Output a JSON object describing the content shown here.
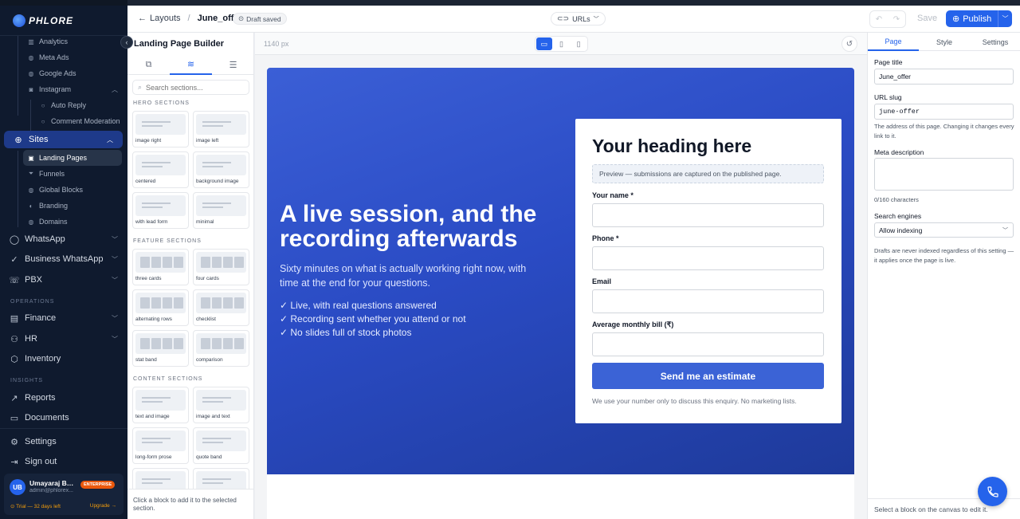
{
  "brand": {
    "logo_text": "PHLORE"
  },
  "sidebar": {
    "items": [
      {
        "label": "Analytics",
        "icon": "chart-icon"
      },
      {
        "label": "Meta Ads",
        "icon": "globe-icon"
      },
      {
        "label": "Google Ads",
        "icon": "globe-icon"
      },
      {
        "label": "Instagram",
        "icon": "camera-icon"
      },
      {
        "label": "Auto Reply",
        "icon": "chat-icon"
      },
      {
        "label": "Comment Moderation",
        "icon": "chat-icon"
      },
      {
        "label": "Sites",
        "icon": "globe-icon"
      },
      {
        "label": "Landing Pages",
        "icon": "layout-icon"
      },
      {
        "label": "Funnels",
        "icon": "funnel-icon"
      },
      {
        "label": "Global Blocks",
        "icon": "globe-icon"
      },
      {
        "label": "Branding",
        "icon": "brush-icon"
      },
      {
        "label": "Domains",
        "icon": "globe-icon"
      },
      {
        "label": "WhatsApp",
        "icon": "whatsapp-icon"
      },
      {
        "label": "Business WhatsApp",
        "icon": "check-circle-icon"
      },
      {
        "label": "PBX",
        "icon": "phone-icon"
      },
      {
        "label": "Finance",
        "icon": "wallet-icon"
      },
      {
        "label": "HR",
        "icon": "people-icon"
      },
      {
        "label": "Inventory",
        "icon": "box-icon"
      },
      {
        "label": "Reports",
        "icon": "trend-icon"
      },
      {
        "label": "Documents",
        "icon": "folder-icon"
      },
      {
        "label": "Settings",
        "icon": "gear-icon"
      },
      {
        "label": "Sign out",
        "icon": "logout-icon"
      }
    ],
    "groups": {
      "operations": "OPERATIONS",
      "insights": "INSIGHTS"
    },
    "user": {
      "initials": "UB",
      "name": "Umayaraj Bal...",
      "email": "admin@phlorex...",
      "badge": "ENTERPRISE",
      "trial": "⊙ Trial — 32 days left",
      "upgrade": "Upgrade →"
    }
  },
  "header": {
    "back_label": "Layouts",
    "page_name": "June_offer",
    "draft_status": "Draft saved",
    "urls_label": "URLs",
    "save_label": "Save",
    "publish_label": "Publish"
  },
  "builder": {
    "title": "Landing Page Builder",
    "search_placeholder": "Search sections...",
    "sections": [
      {
        "title": "HERO SECTIONS",
        "cards": [
          "image right",
          "image left",
          "centered",
          "background image",
          "with lead form",
          "minimal"
        ]
      },
      {
        "title": "FEATURE SECTIONS",
        "cards": [
          "three cards",
          "four cards",
          "alternating rows",
          "checklist",
          "stat band",
          "comparison"
        ]
      },
      {
        "title": "CONTENT SECTIONS",
        "cards": [
          "text and image",
          "image and text",
          "long-form prose",
          "quote band",
          "",
          ""
        ]
      }
    ],
    "footer": "Click a block to add it to the selected section."
  },
  "canvas": {
    "width_label": "1140 px",
    "hero": {
      "heading": "A live session, and the recording afterwards",
      "subheading": "Sixty minutes on what is actually working right now, with time at the end for your questions.",
      "bullets": [
        "✓ Live, with real questions answered",
        "✓ Recording sent whether you attend or not",
        "✓ No slides full of stock photos"
      ],
      "gradient_colors": [
        "#3b5fd6",
        "#1e3a9a"
      ]
    },
    "form": {
      "heading": "Your heading here",
      "preview_note": "Preview — submissions are captured on the published page.",
      "fields": [
        "Your name *",
        "Phone *",
        "Email",
        "Average monthly bill (₹)"
      ],
      "submit_label": "Send me an estimate",
      "footnote": "We use your number only to discuss this enquiry. No marketing lists."
    }
  },
  "props": {
    "tabs": [
      "Page",
      "Style",
      "Settings"
    ],
    "page_title_label": "Page title",
    "page_title_value": "June_offer",
    "slug_label": "URL slug",
    "slug_value": "june-offer",
    "slug_help": "The address of this page. Changing it changes every link to it.",
    "meta_label": "Meta description",
    "meta_count": "0/160 characters",
    "search_label": "Search engines",
    "search_value": "Allow indexing",
    "search_help": "Drafts are never indexed regardless of this setting — it applies once the page is live.",
    "footer": "Select a block on the canvas to edit it."
  },
  "colors": {
    "accent": "#2563eb",
    "sidebar_bg": "#0f1a2e",
    "badge": "#ea580c"
  }
}
